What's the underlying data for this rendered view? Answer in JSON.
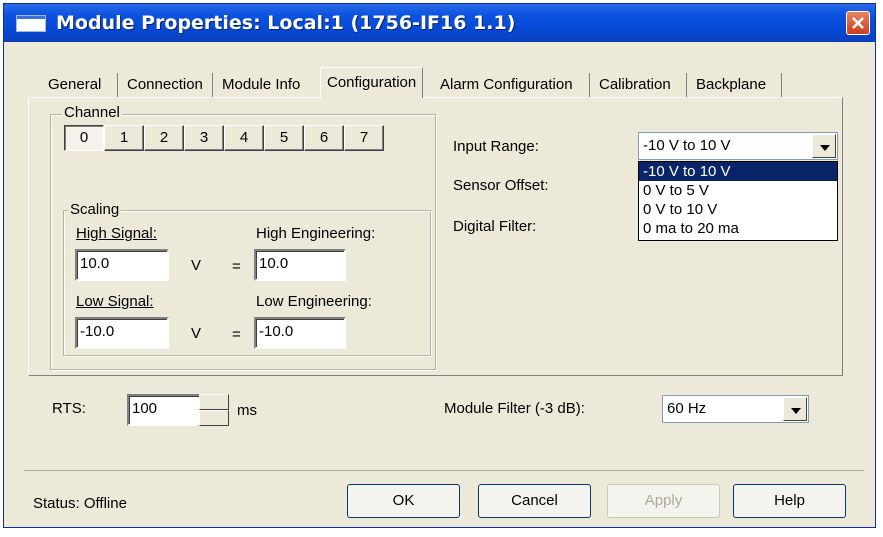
{
  "window": {
    "title": "Module Properties: Local:1 (1756-IF16 1.1)"
  },
  "tabs": [
    {
      "label": "General"
    },
    {
      "label": "Connection"
    },
    {
      "label": "Module Info"
    },
    {
      "label": "Configuration"
    },
    {
      "label": "Alarm Configuration"
    },
    {
      "label": "Calibration"
    },
    {
      "label": "Backplane"
    }
  ],
  "channel": {
    "group_label": "Channel",
    "buttons": [
      "0",
      "1",
      "2",
      "3",
      "4",
      "5",
      "6",
      "7"
    ],
    "selected": "0"
  },
  "scaling": {
    "group_label": "Scaling",
    "high_signal_label": "High Signal:",
    "high_signal_value": "10.0",
    "high_signal_unit": "V",
    "high_eq": "=",
    "high_eng_label": "High Engineering:",
    "high_eng_value": "10.0",
    "low_signal_label": "Low Signal:",
    "low_signal_value": "-10.0",
    "low_signal_unit": "V",
    "low_eq": "=",
    "low_eng_label": "Low Engineering:",
    "low_eng_value": "-10.0"
  },
  "input_range": {
    "label": "Input Range:",
    "value": "-10 V to 10 V",
    "options": [
      "-10 V to 10 V",
      "0 V to 5 V",
      "0 V to 10 V",
      "0 ma to 20 ma"
    ],
    "selected_index": 0
  },
  "sensor_offset": {
    "label": "Sensor Offset:"
  },
  "digital_filter": {
    "label": "Digital Filter:"
  },
  "rts": {
    "label": "RTS:",
    "value": "100",
    "unit": "ms"
  },
  "module_filter": {
    "label": "Module Filter (-3 dB):",
    "value": "60 Hz"
  },
  "status": {
    "text": "Status:  Offline"
  },
  "buttons": {
    "ok": "OK",
    "cancel": "Cancel",
    "apply": "Apply",
    "help": "Help"
  },
  "colors": {
    "titlebar": "#0648d4",
    "dialog_bg": "#ece9d8",
    "selection": "#0a246a"
  }
}
